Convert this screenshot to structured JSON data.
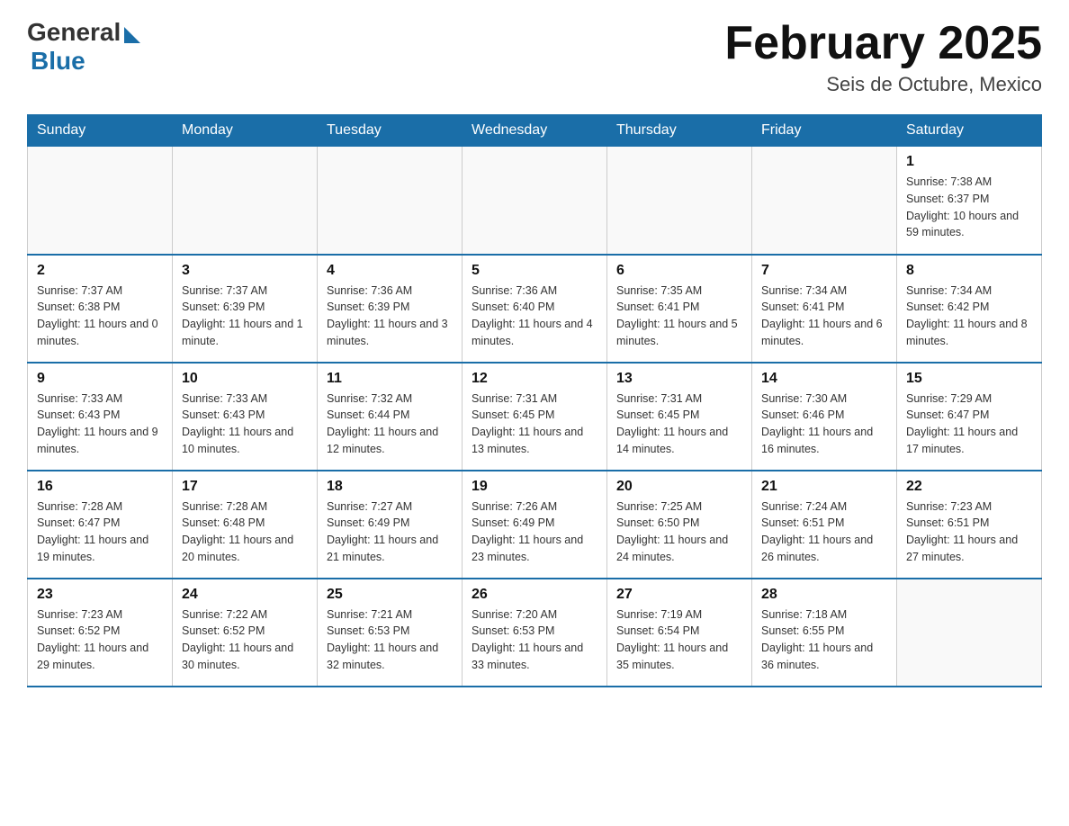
{
  "logo": {
    "general": "General",
    "blue": "Blue"
  },
  "title": "February 2025",
  "subtitle": "Seis de Octubre, Mexico",
  "days_of_week": [
    "Sunday",
    "Monday",
    "Tuesday",
    "Wednesday",
    "Thursday",
    "Friday",
    "Saturday"
  ],
  "weeks": [
    [
      {
        "day": "",
        "info": ""
      },
      {
        "day": "",
        "info": ""
      },
      {
        "day": "",
        "info": ""
      },
      {
        "day": "",
        "info": ""
      },
      {
        "day": "",
        "info": ""
      },
      {
        "day": "",
        "info": ""
      },
      {
        "day": "1",
        "info": "Sunrise: 7:38 AM\nSunset: 6:37 PM\nDaylight: 10 hours and 59 minutes."
      }
    ],
    [
      {
        "day": "2",
        "info": "Sunrise: 7:37 AM\nSunset: 6:38 PM\nDaylight: 11 hours and 0 minutes."
      },
      {
        "day": "3",
        "info": "Sunrise: 7:37 AM\nSunset: 6:39 PM\nDaylight: 11 hours and 1 minute."
      },
      {
        "day": "4",
        "info": "Sunrise: 7:36 AM\nSunset: 6:39 PM\nDaylight: 11 hours and 3 minutes."
      },
      {
        "day": "5",
        "info": "Sunrise: 7:36 AM\nSunset: 6:40 PM\nDaylight: 11 hours and 4 minutes."
      },
      {
        "day": "6",
        "info": "Sunrise: 7:35 AM\nSunset: 6:41 PM\nDaylight: 11 hours and 5 minutes."
      },
      {
        "day": "7",
        "info": "Sunrise: 7:34 AM\nSunset: 6:41 PM\nDaylight: 11 hours and 6 minutes."
      },
      {
        "day": "8",
        "info": "Sunrise: 7:34 AM\nSunset: 6:42 PM\nDaylight: 11 hours and 8 minutes."
      }
    ],
    [
      {
        "day": "9",
        "info": "Sunrise: 7:33 AM\nSunset: 6:43 PM\nDaylight: 11 hours and 9 minutes."
      },
      {
        "day": "10",
        "info": "Sunrise: 7:33 AM\nSunset: 6:43 PM\nDaylight: 11 hours and 10 minutes."
      },
      {
        "day": "11",
        "info": "Sunrise: 7:32 AM\nSunset: 6:44 PM\nDaylight: 11 hours and 12 minutes."
      },
      {
        "day": "12",
        "info": "Sunrise: 7:31 AM\nSunset: 6:45 PM\nDaylight: 11 hours and 13 minutes."
      },
      {
        "day": "13",
        "info": "Sunrise: 7:31 AM\nSunset: 6:45 PM\nDaylight: 11 hours and 14 minutes."
      },
      {
        "day": "14",
        "info": "Sunrise: 7:30 AM\nSunset: 6:46 PM\nDaylight: 11 hours and 16 minutes."
      },
      {
        "day": "15",
        "info": "Sunrise: 7:29 AM\nSunset: 6:47 PM\nDaylight: 11 hours and 17 minutes."
      }
    ],
    [
      {
        "day": "16",
        "info": "Sunrise: 7:28 AM\nSunset: 6:47 PM\nDaylight: 11 hours and 19 minutes."
      },
      {
        "day": "17",
        "info": "Sunrise: 7:28 AM\nSunset: 6:48 PM\nDaylight: 11 hours and 20 minutes."
      },
      {
        "day": "18",
        "info": "Sunrise: 7:27 AM\nSunset: 6:49 PM\nDaylight: 11 hours and 21 minutes."
      },
      {
        "day": "19",
        "info": "Sunrise: 7:26 AM\nSunset: 6:49 PM\nDaylight: 11 hours and 23 minutes."
      },
      {
        "day": "20",
        "info": "Sunrise: 7:25 AM\nSunset: 6:50 PM\nDaylight: 11 hours and 24 minutes."
      },
      {
        "day": "21",
        "info": "Sunrise: 7:24 AM\nSunset: 6:51 PM\nDaylight: 11 hours and 26 minutes."
      },
      {
        "day": "22",
        "info": "Sunrise: 7:23 AM\nSunset: 6:51 PM\nDaylight: 11 hours and 27 minutes."
      }
    ],
    [
      {
        "day": "23",
        "info": "Sunrise: 7:23 AM\nSunset: 6:52 PM\nDaylight: 11 hours and 29 minutes."
      },
      {
        "day": "24",
        "info": "Sunrise: 7:22 AM\nSunset: 6:52 PM\nDaylight: 11 hours and 30 minutes."
      },
      {
        "day": "25",
        "info": "Sunrise: 7:21 AM\nSunset: 6:53 PM\nDaylight: 11 hours and 32 minutes."
      },
      {
        "day": "26",
        "info": "Sunrise: 7:20 AM\nSunset: 6:53 PM\nDaylight: 11 hours and 33 minutes."
      },
      {
        "day": "27",
        "info": "Sunrise: 7:19 AM\nSunset: 6:54 PM\nDaylight: 11 hours and 35 minutes."
      },
      {
        "day": "28",
        "info": "Sunrise: 7:18 AM\nSunset: 6:55 PM\nDaylight: 11 hours and 36 minutes."
      },
      {
        "day": "",
        "info": ""
      }
    ]
  ]
}
